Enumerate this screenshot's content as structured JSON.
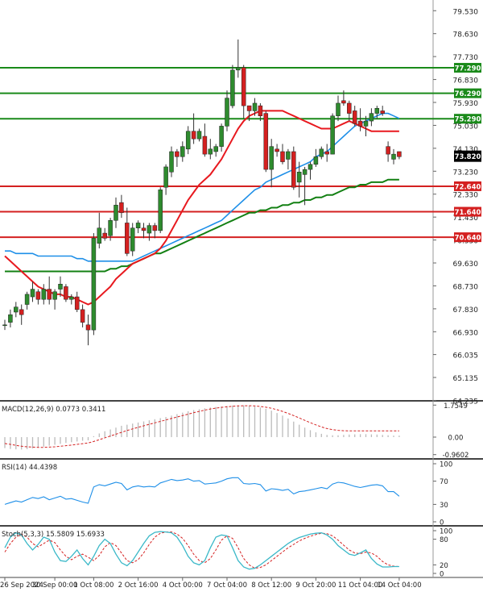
{
  "chart_data": {
    "type": "candlestick",
    "instrument_note": "",
    "colors": {
      "bull": "#2e8b2e",
      "bear": "#d42020",
      "hline_green": "#1a8a1a",
      "hline_red": "#d42020",
      "ma_fast": "#e8191f",
      "ma_mid": "#1e8fe8",
      "ma_slow": "#138013",
      "macd_hist": "#bbbbbb",
      "macd_signal": "#d42020",
      "rsi_line": "#1e8fe8",
      "stoch_k": "#3ab8c8",
      "stoch_d": "#d42020",
      "last_price_bg": "#000000"
    },
    "price_axis": {
      "range": [
        64.25,
        79.95
      ],
      "ticks": [
        "79.530",
        "78.630",
        "77.730",
        "76.830",
        "75.930",
        "75.030",
        "74.130",
        "73.230",
        "72.330",
        "71.430",
        "70.530",
        "69.630",
        "68.730",
        "67.830",
        "66.930",
        "66.035",
        "65.135",
        "64.235"
      ]
    },
    "levels": [
      {
        "label": "77.290",
        "value": 77.29,
        "color": "green"
      },
      {
        "label": "76.290",
        "value": 76.29,
        "color": "green"
      },
      {
        "label": "75.290",
        "value": 75.29,
        "color": "green"
      },
      {
        "label": "72.640",
        "value": 72.64,
        "color": "red"
      },
      {
        "label": "71.640",
        "value": 71.64,
        "color": "red"
      },
      {
        "label": "70.640",
        "value": 70.64,
        "color": "red"
      }
    ],
    "last_price": {
      "label": "73.820",
      "value": 73.82
    },
    "x_axis_labels": [
      {
        "label": "26 Sep 2024",
        "index": 0
      },
      {
        "label": "30 Sep 00:00",
        "index": 9
      },
      {
        "label": "1 Oct 08:00",
        "index": 16
      },
      {
        "label": "2 Oct 16:00",
        "index": 24
      },
      {
        "label": "4 Oct 00:00",
        "index": 32
      },
      {
        "label": "7 Oct 04:00",
        "index": 40
      },
      {
        "label": "8 Oct 12:00",
        "index": 48
      },
      {
        "label": "9 Oct 20:00",
        "index": 56
      },
      {
        "label": "11 Oct 04:00",
        "index": 64
      },
      {
        "label": "14 Oct 04:00",
        "index": 71
      }
    ],
    "candles": [
      [
        67.2,
        67.4,
        67.0,
        67.2
      ],
      [
        67.3,
        67.8,
        67.1,
        67.6
      ],
      [
        67.7,
        68.1,
        67.5,
        67.9
      ],
      [
        67.8,
        68.0,
        67.2,
        67.6
      ],
      [
        68.0,
        68.5,
        67.8,
        68.4
      ],
      [
        68.3,
        68.9,
        68.1,
        68.6
      ],
      [
        68.5,
        68.6,
        68.0,
        68.2
      ],
      [
        68.2,
        68.8,
        68.0,
        68.6
      ],
      [
        68.6,
        69.1,
        68.0,
        68.2
      ],
      [
        68.2,
        68.6,
        67.8,
        68.5
      ],
      [
        68.6,
        69.1,
        68.3,
        68.8
      ],
      [
        68.7,
        68.8,
        68.1,
        68.2
      ],
      [
        68.2,
        68.4,
        68.0,
        68.3
      ],
      [
        68.3,
        68.5,
        67.7,
        67.8
      ],
      [
        67.8,
        68.0,
        67.1,
        67.3
      ],
      [
        67.2,
        67.6,
        66.4,
        67.0
      ],
      [
        67.0,
        70.8,
        66.8,
        70.6
      ],
      [
        70.4,
        71.6,
        70.2,
        71.0
      ],
      [
        70.8,
        71.0,
        70.5,
        70.6
      ],
      [
        70.7,
        71.4,
        70.5,
        71.3
      ],
      [
        71.3,
        72.2,
        71.0,
        71.9
      ],
      [
        72.0,
        72.3,
        71.4,
        71.6
      ],
      [
        71.2,
        71.8,
        69.9,
        70.0
      ],
      [
        70.1,
        71.2,
        69.9,
        71.0
      ],
      [
        71.0,
        71.3,
        70.8,
        71.2
      ],
      [
        71.0,
        71.2,
        70.6,
        70.9
      ],
      [
        70.8,
        71.2,
        70.5,
        71.1
      ],
      [
        71.1,
        71.2,
        70.6,
        70.9
      ],
      [
        70.9,
        72.6,
        70.8,
        72.5
      ],
      [
        72.6,
        73.5,
        72.3,
        73.4
      ],
      [
        73.2,
        74.2,
        73.0,
        74.0
      ],
      [
        74.0,
        74.1,
        73.4,
        73.8
      ],
      [
        73.8,
        74.4,
        73.6,
        74.2
      ],
      [
        74.1,
        75.0,
        73.9,
        74.8
      ],
      [
        74.8,
        75.5,
        74.3,
        74.5
      ],
      [
        74.5,
        74.9,
        74.4,
        74.8
      ],
      [
        74.6,
        75.1,
        73.8,
        73.9
      ],
      [
        73.9,
        74.5,
        73.7,
        74.1
      ],
      [
        74.0,
        74.3,
        73.8,
        74.2
      ],
      [
        74.2,
        75.1,
        74.0,
        75.0
      ],
      [
        75.0,
        76.4,
        74.8,
        76.1
      ],
      [
        75.8,
        77.4,
        75.7,
        77.2
      ],
      [
        77.2,
        78.4,
        76.9,
        77.3
      ],
      [
        77.3,
        77.4,
        75.3,
        75.8
      ],
      [
        75.8,
        75.8,
        75.2,
        75.6
      ],
      [
        75.6,
        76.1,
        75.4,
        75.9
      ],
      [
        75.8,
        75.9,
        75.2,
        75.4
      ],
      [
        75.5,
        75.6,
        73.2,
        73.3
      ],
      [
        73.3,
        74.5,
        72.6,
        74.2
      ],
      [
        74.1,
        74.3,
        73.8,
        74.0
      ],
      [
        74.0,
        74.3,
        73.5,
        73.6
      ],
      [
        73.7,
        74.1,
        73.3,
        74.0
      ],
      [
        74.0,
        74.2,
        72.5,
        72.6
      ],
      [
        72.8,
        73.6,
        72.2,
        73.2
      ],
      [
        73.1,
        73.4,
        71.9,
        73.3
      ],
      [
        73.3,
        73.6,
        72.9,
        73.5
      ],
      [
        73.5,
        74.1,
        73.4,
        73.8
      ],
      [
        73.8,
        74.2,
        73.7,
        74.1
      ],
      [
        74.0,
        74.3,
        73.6,
        73.9
      ],
      [
        73.9,
        75.5,
        73.9,
        75.4
      ],
      [
        75.4,
        76.2,
        75.2,
        75.9
      ],
      [
        76.0,
        76.4,
        75.8,
        75.9
      ],
      [
        75.9,
        76.0,
        75.2,
        75.5
      ],
      [
        75.6,
        75.8,
        75.0,
        75.1
      ],
      [
        75.2,
        75.7,
        74.8,
        75.0
      ],
      [
        75.0,
        75.4,
        74.6,
        75.2
      ],
      [
        75.2,
        75.7,
        75.0,
        75.5
      ],
      [
        75.5,
        75.8,
        75.3,
        75.7
      ],
      [
        75.6,
        75.8,
        75.4,
        75.5
      ],
      [
        74.2,
        74.4,
        73.6,
        73.9
      ],
      [
        73.7,
        74.1,
        73.5,
        73.9
      ],
      [
        74.0,
        74.0,
        73.7,
        73.8
      ]
    ],
    "ma_fast": [
      69.9,
      69.7,
      69.5,
      69.3,
      69.1,
      68.9,
      68.7,
      68.6,
      68.5,
      68.4,
      68.4,
      68.3,
      68.3,
      68.2,
      68.1,
      68.0,
      68.1,
      68.3,
      68.5,
      68.7,
      69.0,
      69.2,
      69.4,
      69.6,
      69.7,
      69.8,
      69.9,
      70.0,
      70.2,
      70.5,
      70.9,
      71.3,
      71.7,
      72.1,
      72.4,
      72.7,
      72.9,
      73.1,
      73.4,
      73.7,
      74.1,
      74.5,
      74.9,
      75.2,
      75.4,
      75.5,
      75.6,
      75.6,
      75.6,
      75.6,
      75.6,
      75.5,
      75.4,
      75.3,
      75.2,
      75.1,
      75.0,
      74.9,
      74.9,
      74.9,
      75.0,
      75.1,
      75.2,
      75.1,
      75.0,
      74.9,
      74.8,
      74.8,
      74.8,
      74.8,
      74.8,
      74.8
    ],
    "ma_mid": [
      70.1,
      70.1,
      70.0,
      70.0,
      70.0,
      70.0,
      69.9,
      69.9,
      69.9,
      69.9,
      69.9,
      69.9,
      69.9,
      69.8,
      69.8,
      69.7,
      69.7,
      69.7,
      69.7,
      69.7,
      69.7,
      69.7,
      69.7,
      69.7,
      69.8,
      69.9,
      70.0,
      70.1,
      70.2,
      70.3,
      70.4,
      70.5,
      70.6,
      70.7,
      70.8,
      70.9,
      71.0,
      71.1,
      71.2,
      71.3,
      71.5,
      71.7,
      71.9,
      72.1,
      72.3,
      72.5,
      72.6,
      72.8,
      72.9,
      73.0,
      73.1,
      73.2,
      73.3,
      73.4,
      73.5,
      73.6,
      73.8,
      73.9,
      74.0,
      74.2,
      74.4,
      74.6,
      74.8,
      75.0,
      75.1,
      75.2,
      75.3,
      75.4,
      75.5,
      75.5,
      75.4,
      75.3
    ],
    "ma_slow": [
      69.3,
      69.3,
      69.3,
      69.3,
      69.3,
      69.3,
      69.3,
      69.3,
      69.3,
      69.3,
      69.3,
      69.3,
      69.3,
      69.3,
      69.3,
      69.3,
      69.3,
      69.3,
      69.3,
      69.4,
      69.4,
      69.5,
      69.5,
      69.6,
      69.7,
      69.8,
      69.9,
      70.0,
      70.0,
      70.1,
      70.2,
      70.3,
      70.4,
      70.5,
      70.6,
      70.7,
      70.8,
      70.9,
      71.0,
      71.1,
      71.2,
      71.3,
      71.4,
      71.5,
      71.6,
      71.6,
      71.7,
      71.7,
      71.8,
      71.8,
      71.9,
      71.9,
      72.0,
      72.0,
      72.1,
      72.1,
      72.2,
      72.2,
      72.3,
      72.3,
      72.4,
      72.5,
      72.6,
      72.6,
      72.7,
      72.7,
      72.8,
      72.8,
      72.8,
      72.9,
      72.9,
      72.9
    ],
    "macd": {
      "label": "MACD(12,26,9) 0.0773 0.3411",
      "ticks": [
        "1.7549",
        "0.00",
        "-0.9602"
      ],
      "range": [
        -1.15,
        1.9
      ],
      "hist": [
        -0.6,
        -0.65,
        -0.67,
        -0.68,
        -0.66,
        -0.62,
        -0.57,
        -0.52,
        -0.47,
        -0.42,
        -0.37,
        -0.32,
        -0.28,
        -0.24,
        -0.2,
        -0.18,
        0.05,
        0.2,
        0.32,
        0.42,
        0.52,
        0.62,
        0.68,
        0.74,
        0.8,
        0.86,
        0.92,
        0.98,
        1.04,
        1.1,
        1.18,
        1.26,
        1.34,
        1.42,
        1.48,
        1.53,
        1.58,
        1.62,
        1.65,
        1.68,
        1.71,
        1.73,
        1.74,
        1.74,
        1.72,
        1.68,
        1.62,
        1.55,
        1.45,
        1.32,
        1.18,
        1.02,
        0.85,
        0.68,
        0.52,
        0.38,
        0.26,
        0.18,
        0.12,
        0.1,
        0.1,
        0.12,
        0.14,
        0.15,
        0.16,
        0.16,
        0.15,
        0.14,
        0.12,
        0.1,
        0.08,
        0.08
      ],
      "signal": [
        -0.35,
        -0.4,
        -0.45,
        -0.5,
        -0.53,
        -0.55,
        -0.56,
        -0.56,
        -0.55,
        -0.53,
        -0.5,
        -0.47,
        -0.44,
        -0.4,
        -0.36,
        -0.32,
        -0.24,
        -0.14,
        -0.04,
        0.06,
        0.16,
        0.26,
        0.36,
        0.45,
        0.54,
        0.62,
        0.7,
        0.78,
        0.86,
        0.94,
        1.02,
        1.1,
        1.18,
        1.26,
        1.34,
        1.41,
        1.48,
        1.54,
        1.59,
        1.63,
        1.66,
        1.69,
        1.71,
        1.72,
        1.72,
        1.71,
        1.68,
        1.64,
        1.58,
        1.5,
        1.41,
        1.3,
        1.18,
        1.05,
        0.92,
        0.79,
        0.67,
        0.56,
        0.47,
        0.41,
        0.37,
        0.35,
        0.34,
        0.34,
        0.34,
        0.34,
        0.34,
        0.34,
        0.34,
        0.34,
        0.34,
        0.34
      ]
    },
    "rsi": {
      "label": "RSI(14) 44.4398",
      "ticks": [
        "100",
        "70",
        "30",
        "0"
      ],
      "values": [
        30,
        33,
        36,
        34,
        38,
        42,
        40,
        43,
        38,
        41,
        44,
        39,
        40,
        37,
        34,
        32,
        60,
        64,
        62,
        65,
        68,
        66,
        55,
        60,
        62,
        60,
        61,
        60,
        67,
        70,
        73,
        71,
        72,
        74,
        70,
        71,
        65,
        66,
        67,
        70,
        74,
        76,
        76,
        66,
        65,
        66,
        64,
        53,
        57,
        56,
        54,
        56,
        48,
        52,
        53,
        55,
        57,
        59,
        57,
        65,
        68,
        67,
        64,
        61,
        59,
        61,
        63,
        64,
        62,
        52,
        52,
        44
      ]
    },
    "stoch": {
      "label": "Stoch(5,3,3) 15.5809 15.6933",
      "ticks": [
        "100",
        "80",
        "20",
        "0"
      ],
      "k": [
        60,
        85,
        95,
        90,
        70,
        55,
        68,
        85,
        80,
        50,
        30,
        28,
        40,
        55,
        35,
        20,
        40,
        65,
        80,
        70,
        45,
        25,
        18,
        30,
        50,
        70,
        88,
        96,
        98,
        97,
        95,
        85,
        65,
        40,
        25,
        20,
        30,
        60,
        85,
        90,
        88,
        60,
        30,
        15,
        10,
        12,
        20,
        30,
        40,
        50,
        60,
        70,
        78,
        84,
        88,
        92,
        94,
        95,
        90,
        80,
        65,
        55,
        45,
        42,
        48,
        55,
        35,
        22,
        15,
        15,
        16,
        16
      ],
      "d": [
        50,
        70,
        85,
        92,
        85,
        70,
        62,
        70,
        78,
        72,
        55,
        40,
        32,
        40,
        45,
        38,
        30,
        42,
        62,
        72,
        65,
        48,
        30,
        25,
        32,
        48,
        68,
        85,
        94,
        97,
        97,
        92,
        82,
        65,
        45,
        30,
        25,
        35,
        55,
        78,
        88,
        82,
        60,
        35,
        20,
        12,
        14,
        20,
        30,
        40,
        50,
        60,
        68,
        76,
        82,
        87,
        91,
        94,
        93,
        88,
        78,
        66,
        55,
        48,
        46,
        50,
        48,
        40,
        28,
        20,
        17,
        16
      ]
    }
  }
}
